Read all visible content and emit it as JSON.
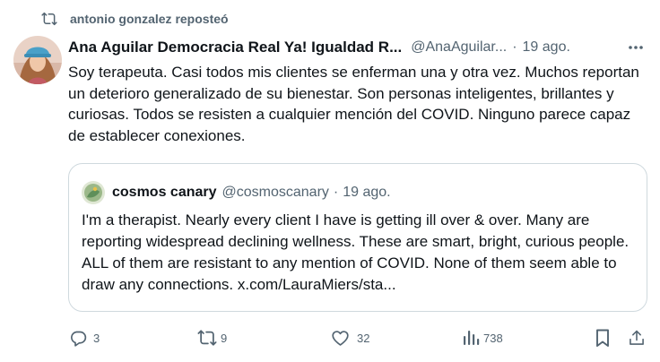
{
  "repost": {
    "icon": "repost-icon",
    "text": "antonio gonzalez reposteó"
  },
  "tweet": {
    "author_name": "Ana Aguilar Democracia Real Ya! Igualdad R...",
    "author_handle": "@AnaAguilar...",
    "separator": "·",
    "date": "19 ago.",
    "more_icon": "more-horizontal-icon",
    "text": "Soy terapeuta. Casi todos mis clientes se enferman una y otra vez. Muchos reportan un deterioro generalizado de su bienestar. Son personas inteligentes, brillantes y curiosas. Todos se resisten a cualquier mención del COVID. Ninguno parece capaz de establecer conexiones."
  },
  "quote": {
    "author_name": "cosmos canary",
    "author_handle": "@cosmoscanary",
    "separator": "·",
    "date": "19 ago.",
    "text": "I'm a therapist. Nearly every client I have is getting ill over & over. Many are reporting widespread declining wellness. These are smart, bright, curious people. ALL of them are resistant to any mention of COVID. None of them seem able to draw any connections. x.com/LauraMiers/sta..."
  },
  "actions": {
    "reply_count": "3",
    "repost_count": "9",
    "like_count": "32",
    "views_count": "738"
  },
  "colors": {
    "text": "#0f1419",
    "secondary": "#536471",
    "border": "#cfd9de"
  }
}
